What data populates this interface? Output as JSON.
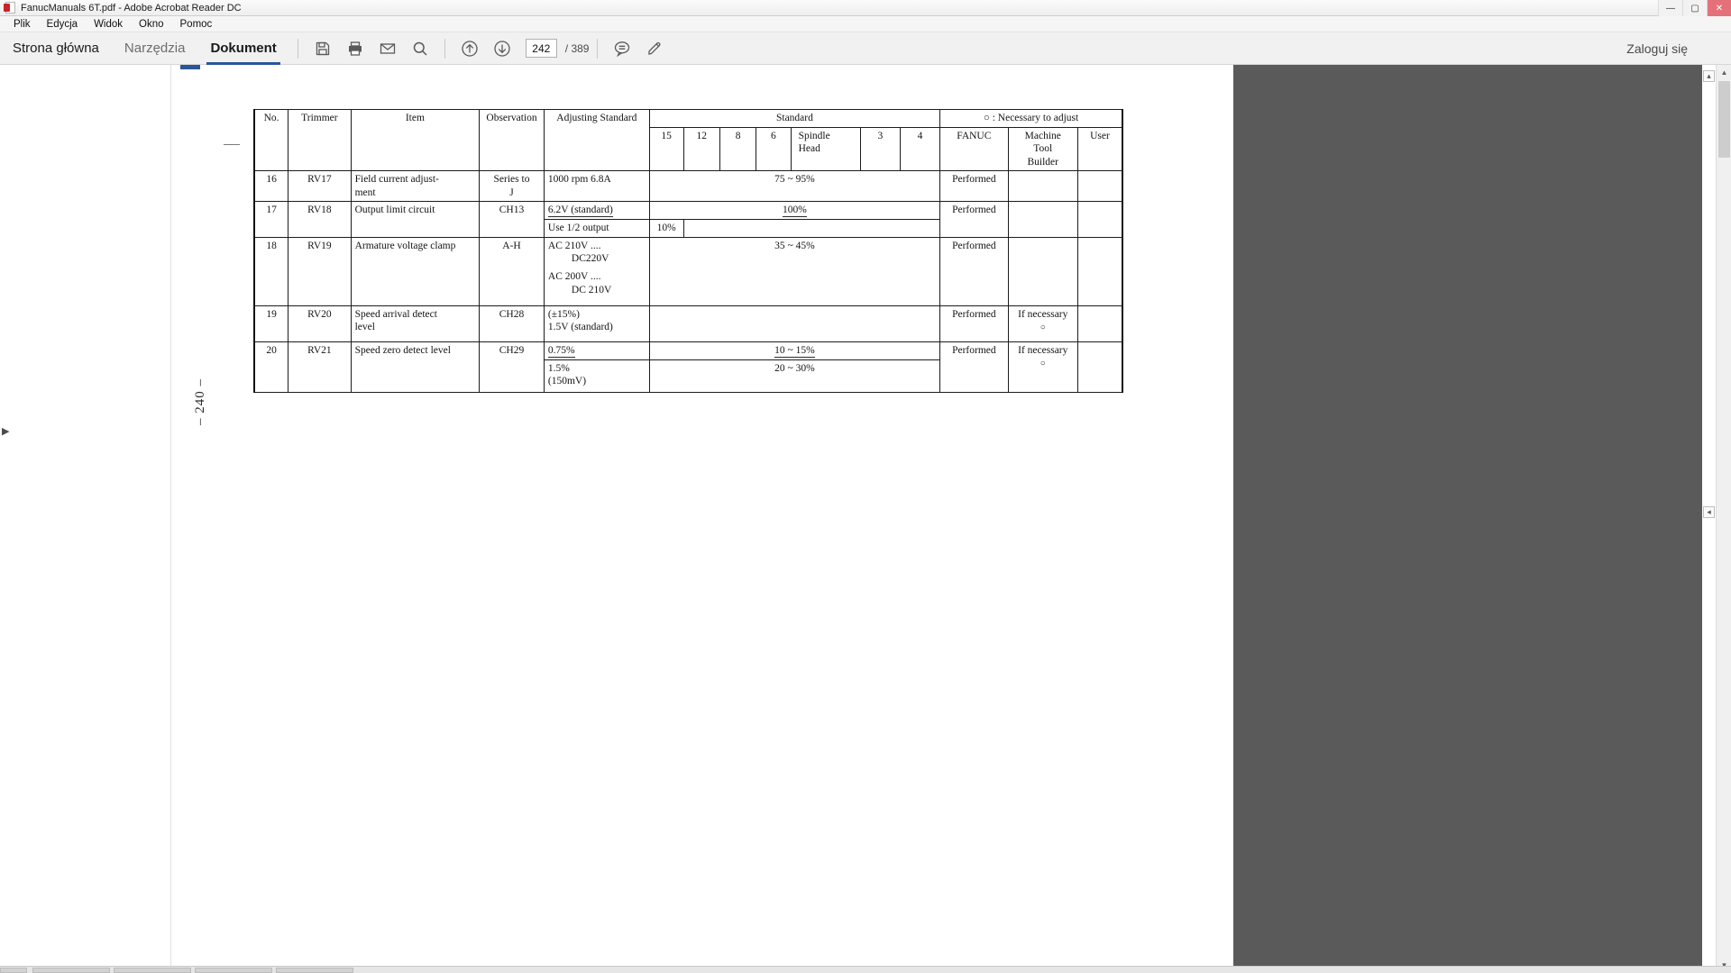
{
  "window": {
    "title": "FanucManuals 6T.pdf - Adobe Acrobat Reader DC",
    "app_icon": "pdf-document-icon",
    "buttons": {
      "minimize": "—",
      "maximize": "▢",
      "close": "✕"
    }
  },
  "menubar": {
    "items": [
      {
        "label": "Plik"
      },
      {
        "label": "Edycja"
      },
      {
        "label": "Widok"
      },
      {
        "label": "Okno"
      },
      {
        "label": "Pomoc"
      }
    ]
  },
  "toolbar": {
    "tabs": [
      {
        "label": "Strona główna",
        "active": false
      },
      {
        "label": "Narzędzia",
        "active": false
      },
      {
        "label": "Dokument",
        "active": true
      }
    ],
    "icons": [
      {
        "name": "save-icon"
      },
      {
        "name": "print-icon"
      },
      {
        "name": "email-icon"
      },
      {
        "name": "search-icon"
      },
      {
        "name": "previous-page-icon"
      },
      {
        "name": "next-page-icon"
      },
      {
        "name": "comment-icon"
      },
      {
        "name": "highlight-icon"
      }
    ],
    "page_number": "242",
    "page_total": "/ 389",
    "sign_in_label": "Zaloguj się"
  },
  "document": {
    "page_label": "– 240 –",
    "table": {
      "header": {
        "no": "No.",
        "trimmer": "Trimmer",
        "item": "Item",
        "observation": "Observation",
        "adjusting_standard": "Adjusting Standard",
        "standard_group": "Standard",
        "standard_cols": [
          "15",
          "12",
          "8",
          "6",
          "Spindle\nHead",
          "3",
          "4"
        ],
        "spindle_head_line1": "Spindle",
        "spindle_head_line2": "Head",
        "necessary_note": "○ : Necessary to adjust",
        "fanuc": "FANUC",
        "mtb_line1": "Machine",
        "mtb_line2": "Tool",
        "mtb_line3": "Builder",
        "user": "User"
      },
      "rows": [
        {
          "no": "16",
          "trimmer": "RV17",
          "item_l1": "Field current adjust-",
          "item_l2": "ment",
          "observation_l1": "Series to",
          "observation_l2": "J",
          "adjusting": "1000 rpm     6.8A",
          "standard_value": "75 ~ 95%",
          "fanuc": "Performed",
          "mtb": "",
          "user": ""
        },
        {
          "no": "17",
          "trimmer": "RV18",
          "item_l1": "Output limit circuit",
          "observation_l1": "CH13",
          "adjusting_a": "6.2V (standard)",
          "adjusting_b": "Use 1/2 output",
          "standard_value_a": "100%",
          "standard_value_b": "10%",
          "fanuc": "Performed",
          "mtb": "",
          "user": ""
        },
        {
          "no": "18",
          "trimmer": "RV19",
          "item_l1": "Armature voltage clamp",
          "observation_l1": "A-H",
          "adjusting_l1": "AC 210V ....",
          "adjusting_l2": "DC220V",
          "adjusting_l3": "AC 200V ....",
          "adjusting_l4": "DC 210V",
          "standard_value": "35 ~ 45%",
          "fanuc": "Performed",
          "mtb": "",
          "user": ""
        },
        {
          "no": "19",
          "trimmer": "RV20",
          "item_l1": "Speed arrival detect",
          "item_l2": "level",
          "observation_l1": "CH28",
          "adjusting_l1": "(±15%)",
          "adjusting_l2": "1.5V (standard)",
          "standard_value": "",
          "fanuc": "Performed",
          "mtb": "If necessary",
          "mtb_mark": "○",
          "user": ""
        },
        {
          "no": "20",
          "trimmer": "RV21",
          "item_l1": "Speed zero detect level",
          "observation_l1": "CH29",
          "adjusting_l1": "0.75%",
          "adjusting_l2": "1.5%",
          "adjusting_l3": "(150mV)",
          "standard_value_a": "10 ~ 15%",
          "standard_value_b": "20 ~ 30%",
          "fanuc": "Performed",
          "mtb": "If necessary",
          "mtb_mark": "○",
          "user": ""
        }
      ]
    }
  },
  "colors": {
    "accent": "#2a5699",
    "titlebar_close": "#e4717a",
    "toolbar_bg": "#f1f1f1",
    "viewer_bg": "#5a5a5a"
  }
}
